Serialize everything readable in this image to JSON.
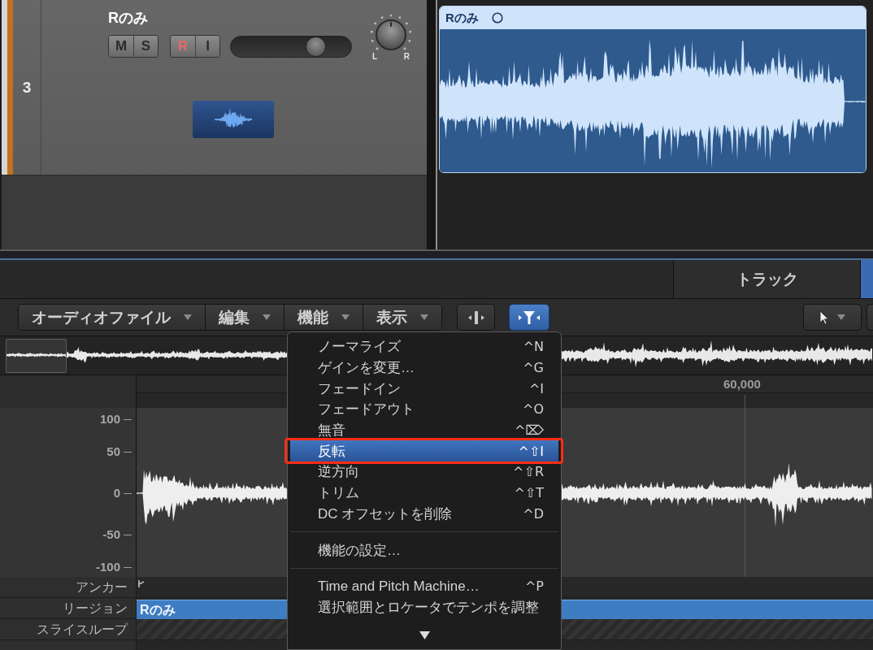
{
  "track": {
    "number": "3",
    "name": "Rのみ",
    "button_groups": [
      [
        {
          "label": "M",
          "kind": "mute"
        },
        {
          "label": "S",
          "kind": "solo"
        }
      ],
      [
        {
          "label": "R",
          "kind": "record"
        },
        {
          "label": "I",
          "kind": "input"
        }
      ]
    ],
    "volume": {
      "level": 0.7
    },
    "pan": {
      "left_label": "L",
      "right_label": "R"
    }
  },
  "region": {
    "name": "Rのみ",
    "selected": true
  },
  "tabs": [
    {
      "label": "トラック",
      "selected": false
    },
    {
      "selected": true
    }
  ],
  "toolbar": {
    "menus": [
      {
        "label": "オーディオファイル"
      },
      {
        "label": "編集"
      },
      {
        "label": "機能"
      },
      {
        "label": "表示"
      }
    ],
    "tools": [
      {
        "kind": "split",
        "selected": false
      },
      {
        "kind": "funnel",
        "selected": true
      }
    ]
  },
  "ruler": {
    "labels": [
      "60,000"
    ]
  },
  "amplitude_axis": [
    "100",
    "50",
    "0",
    "-50",
    "-100"
  ],
  "lanes": [
    {
      "kind": "anchor",
      "label": "アンカー"
    },
    {
      "kind": "region",
      "label": "リージョン",
      "value": "Rのみ"
    },
    {
      "kind": "slices",
      "label": "スライスループ"
    }
  ],
  "menu": {
    "items": [
      {
        "kind": "item",
        "label": "ノーマライズ",
        "shortcut": "^N",
        "selected": false,
        "highlighted": false
      },
      {
        "kind": "item",
        "label": "ゲインを変更…",
        "shortcut": "^G",
        "selected": false,
        "highlighted": false
      },
      {
        "kind": "item",
        "label": "フェードイン",
        "shortcut": "^I",
        "selected": false,
        "highlighted": false
      },
      {
        "kind": "item",
        "label": "フェードアウト",
        "shortcut": "^O",
        "selected": false,
        "highlighted": false
      },
      {
        "kind": "item",
        "label": "無音",
        "shortcut": "^⌦",
        "selected": false,
        "highlighted": false
      },
      {
        "kind": "item",
        "label": "反転",
        "shortcut": "^⇧I",
        "selected": true,
        "highlighted": true
      },
      {
        "kind": "item",
        "label": "逆方向",
        "shortcut": "^⇧R",
        "selected": false,
        "highlighted": false
      },
      {
        "kind": "item",
        "label": "トリム",
        "shortcut": "^⇧T",
        "selected": false,
        "highlighted": false
      },
      {
        "kind": "item",
        "label": "DC オフセットを削除",
        "shortcut": "^D",
        "selected": false,
        "highlighted": false
      },
      {
        "kind": "separator"
      },
      {
        "kind": "item",
        "label": "機能の設定…",
        "selected": false,
        "highlighted": false
      },
      {
        "kind": "separator"
      },
      {
        "kind": "item",
        "label": "Time and Pitch Machine…",
        "shortcut": "^P",
        "selected": false,
        "highlighted": false
      },
      {
        "kind": "item",
        "label": "選択範囲とロケータでテンポを調整",
        "selected": false,
        "highlighted": false
      }
    ]
  }
}
